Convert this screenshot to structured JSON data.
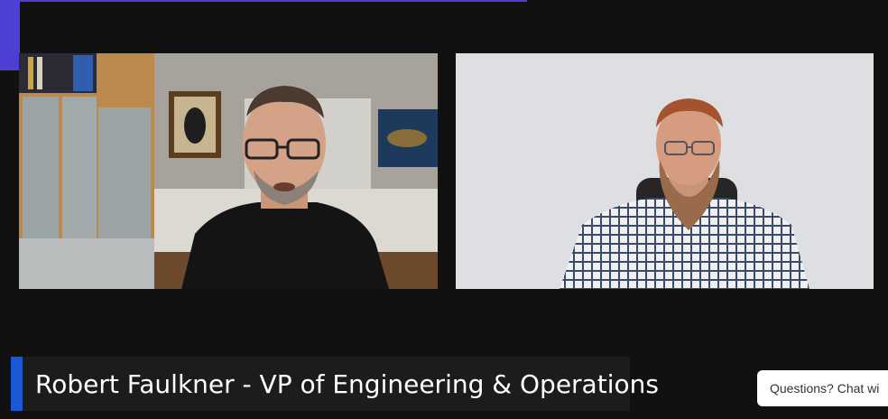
{
  "participants": [
    {
      "tile": "left"
    },
    {
      "tile": "right"
    }
  ],
  "lower_third": {
    "name_title": "Robert Faulkner - VP of Engineering & Operations"
  },
  "chat_widget": {
    "label": "Questions? Chat wi"
  },
  "colors": {
    "background": "#111111",
    "accent": "#4b3fd6",
    "lower_third_stripe": "#1c57d6",
    "lower_third_bg": "#1c1c1c"
  }
}
